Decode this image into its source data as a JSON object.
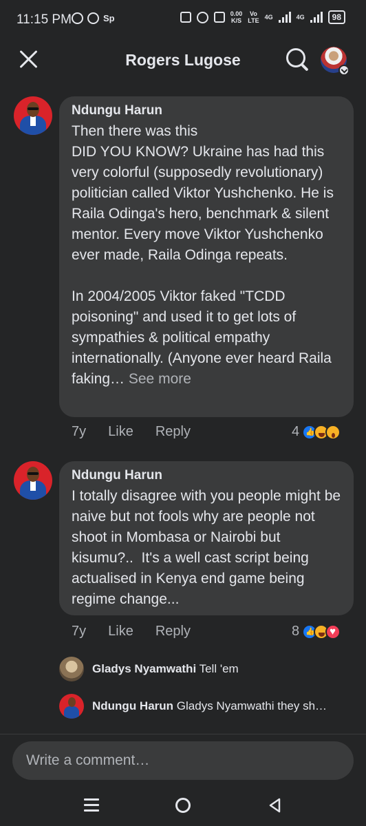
{
  "status_bar": {
    "time": "11:15 PM",
    "sp_label": "Sp",
    "net_speed_value": "0.00",
    "net_speed_unit": "K/S",
    "volte_top": "Vo",
    "volte_bottom": "LTE",
    "net1": "4G",
    "net2": "4G",
    "battery": "98"
  },
  "header": {
    "title": "Rogers Lugose"
  },
  "comments": [
    {
      "author": "Ndungu Harun",
      "text": "Then there was this\nDID YOU KNOW? Ukraine has had this very colorful (supposedly revolutionary) politician called Viktor Yushchenko. He is Raila Odinga's hero, benchmark & silent mentor. Every move Viktor Yushchenko ever made, Raila Odinga repeats.\n\nIn 2004/2005 Viktor faked \"TCDD poisoning\" and used it to get lots of sympathies & political empathy internationally. (Anyone ever heard Raila faking… ",
      "see_more": "See more",
      "time": "7y",
      "like_label": "Like",
      "reply_label": "Reply",
      "reaction_count": "4"
    },
    {
      "author": "Ndungu Harun",
      "text": "I totally disagree with you people might be naive but not fools why are people not shoot in Mombasa or Nairobi but kisumu?..  It's a well cast script being actualised in Kenya end game being regime change...",
      "time": "7y",
      "like_label": "Like",
      "reply_label": "Reply",
      "reaction_count": "8"
    }
  ],
  "replies": [
    {
      "author": "Gladys Nyamwathi",
      "text": "Tell 'em"
    },
    {
      "author": "Ndungu Harun",
      "text": "Gladys Nyamwathi they sh…"
    }
  ],
  "composer": {
    "placeholder": "Write a comment…"
  },
  "colors": {
    "background": "#242526",
    "bubble": "#3a3b3c",
    "text": "#e4e6eb",
    "muted": "#b0b3b8",
    "like_blue": "#1877f2"
  }
}
